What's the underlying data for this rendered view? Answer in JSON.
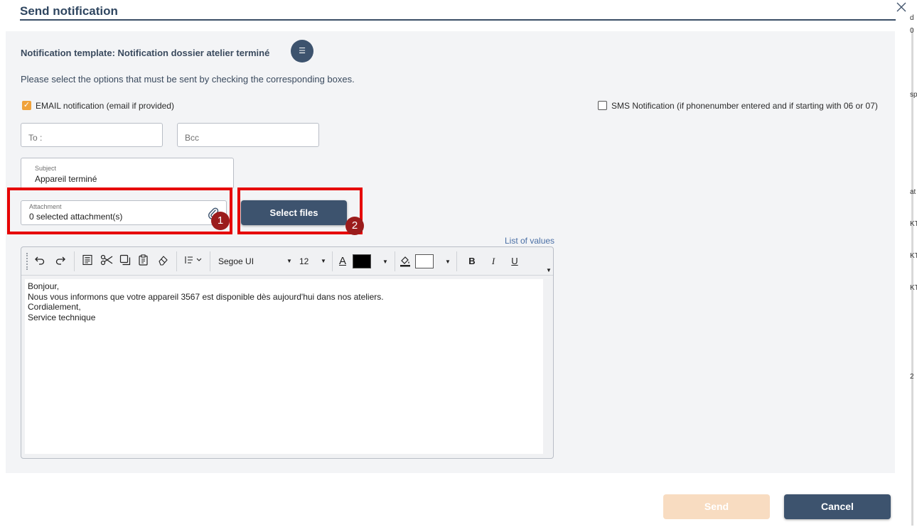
{
  "dialog": {
    "title": "Send notification",
    "close_icon": "close-icon"
  },
  "template": {
    "label": "Notification template: Notification dossier atelier terminé",
    "menu_icon": "list-icon",
    "menu_glyph": "☰"
  },
  "instruction": "Please select the options that must be sent by checking the corresponding boxes.",
  "options": {
    "email_label": "EMAIL notification (email if provided)",
    "email_checked": true,
    "sms_label": "SMS Notification (if phonenumber entered and if starting with 06 or 07)",
    "sms_checked": false
  },
  "fields": {
    "to_placeholder": "To :",
    "bcc_placeholder": "Bcc",
    "subject_label": "Subject",
    "subject_value": "Appareil terminé",
    "attachment_label": "Attachment",
    "attachment_value": "0 selected attachment(s)",
    "attachment_icon": "paperclip-icon"
  },
  "buttons": {
    "select_files": "Select files",
    "send": "Send",
    "cancel": "Cancel"
  },
  "annotations": {
    "step1": "1",
    "step2": "2",
    "highlight_color": "#e60000",
    "badge_color": "#9b1c1c"
  },
  "editor": {
    "list_of_values_link": "List of values",
    "toolbar": {
      "undo_icon": "undo-icon",
      "redo_icon": "redo-icon",
      "select_all_icon": "select-all-icon",
      "cut_icon": "cut-icon",
      "copy_icon": "copy-icon",
      "paste_icon": "paste-icon",
      "clear_format_icon": "clear-format-icon",
      "paragraph_icon": "paragraph-icon",
      "font_family": "Segoe UI",
      "font_size": "12",
      "text_color_label": "A",
      "text_color": "#000000",
      "highlight_color": "#ffffff",
      "bold": "B",
      "italic": "I",
      "underline": "U"
    },
    "content_lines": [
      "Bonjour,",
      "Nous vous informons que votre appareil 3567 est disponible dès aujourd'hui dans nos ateliers.",
      "Cordialement,",
      "Service technique"
    ]
  },
  "colors": {
    "primary": "#3d536e",
    "accent_checkbox": "#f0a23b",
    "send_disabled": "#f8dcc1"
  },
  "background_fragments": [
    "d",
    "0",
    "sp",
    "at",
    "KT",
    "KT",
    "KT",
    "2"
  ]
}
